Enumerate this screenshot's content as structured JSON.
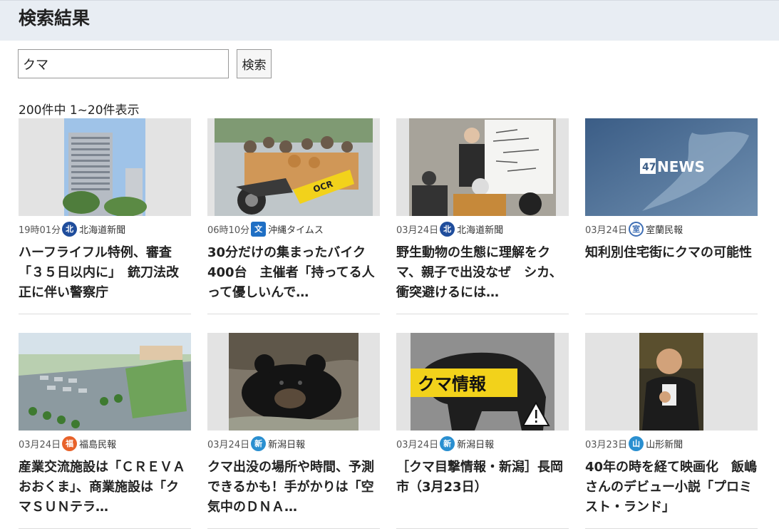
{
  "page": {
    "title": "検索結果"
  },
  "search": {
    "value": "クマ",
    "button_label": "検索"
  },
  "results_count": "200件中 1~20件表示",
  "articles": [
    {
      "time": "19時01分",
      "source": "北海道新聞",
      "title": "ハーフライフル特例、審査「３５日以内に」　銃刀法改正に伴い警察庁",
      "source_icon": "hokkaido-shimbun-icon",
      "icon_color": "#1f4d9c"
    },
    {
      "time": "06時10分",
      "source": "沖縄タイムス",
      "title": "30分だけの集まったバイク400台　主催者「持ってる人って優しいんで…",
      "source_icon": "okinawa-times-icon",
      "icon_color": "#1f6fc4"
    },
    {
      "time": "03月24日",
      "source": "北海道新聞",
      "title": "野生動物の生態に理解をクマ、親子で出没なぜ　シカ、衝突避けるには…",
      "source_icon": "hokkaido-shimbun-icon",
      "icon_color": "#1f4d9c"
    },
    {
      "time": "03月24日",
      "source": "室蘭民報",
      "title": "知利別住宅街にクマの可能性",
      "source_icon": "muroran-minpo-icon",
      "icon_color": "#3f6fb5"
    },
    {
      "time": "03月24日",
      "source": "福島民報",
      "title": "産業交流施設は「ＣＲＥＶＡおおくま」、商業施設は「クマＳＵＮテラ…",
      "source_icon": "fukushima-minpo-icon",
      "icon_color": "#e8622a"
    },
    {
      "time": "03月24日",
      "source": "新潟日報",
      "title": "クマ出没の場所や時間、予測できるかも！手がかりは「空気中のＤＮＡ…",
      "source_icon": "niigata-nippo-icon",
      "icon_color": "#2a8fd0"
    },
    {
      "time": "03月24日",
      "source": "新潟日報",
      "title": "［クマ目撃情報・新潟］長岡市（3月23日）",
      "source_icon": "niigata-nippo-icon",
      "icon_color": "#2a8fd0"
    },
    {
      "time": "03月23日",
      "source": "山形新聞",
      "title": "40年の時を経て映画化　飯嶋さんのデビュー小説「プロミスト・ランド」",
      "source_icon": "yamagata-shimbun-icon",
      "icon_color": "#2a8fd0"
    }
  ],
  "thumb_texts": {
    "news_logo": "47NEWS",
    "kuma_label": "クマ情報",
    "ocr": "OCR"
  }
}
